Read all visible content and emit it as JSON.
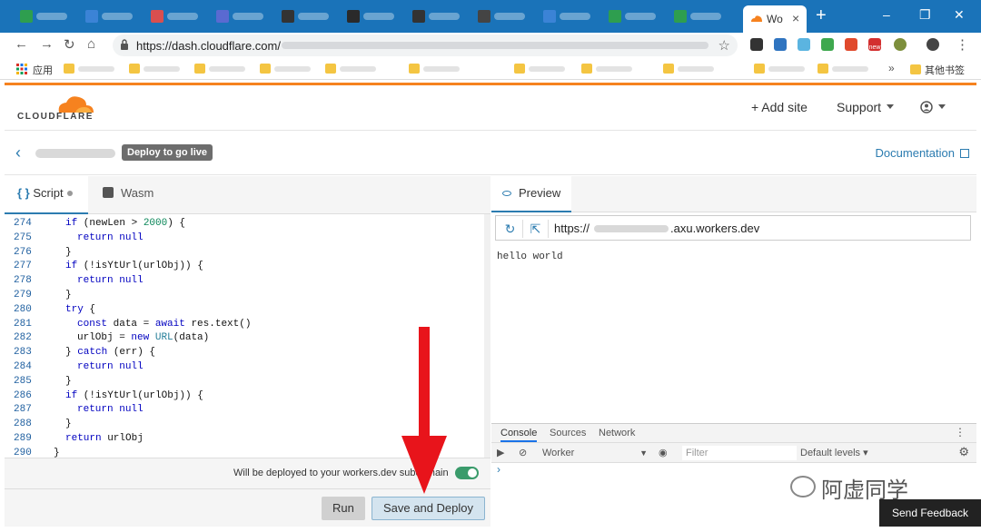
{
  "browser": {
    "active_tab_title": "Wo",
    "url_shown": "https://dash.cloudflare.com/",
    "bookmarks_apps_label": "应用",
    "bookmarks_more": "»",
    "bookmarks_other": "其他书签",
    "extension_badge": "new"
  },
  "header": {
    "logo_text": "CLOUDFLARE",
    "add_site": "+ Add site",
    "support": "Support"
  },
  "subheader": {
    "badge": "Deploy to go live",
    "documentation": "Documentation"
  },
  "editor": {
    "tabs": [
      {
        "label": "Script"
      },
      {
        "label": "Wasm"
      }
    ],
    "lines": [
      {
        "n": "274",
        "indent": 1,
        "code": "if (newLen > 2000) {"
      },
      {
        "n": "275",
        "indent": 2,
        "code": "return null"
      },
      {
        "n": "276",
        "indent": 1,
        "code": "}"
      },
      {
        "n": "277",
        "indent": 1,
        "code": "if (!isYtUrl(urlObj)) {"
      },
      {
        "n": "278",
        "indent": 2,
        "code": "return null"
      },
      {
        "n": "279",
        "indent": 1,
        "code": "}"
      },
      {
        "n": "280",
        "indent": 1,
        "code": "try {"
      },
      {
        "n": "281",
        "indent": 2,
        "code": "const data = await res.text()"
      },
      {
        "n": "282",
        "indent": 2,
        "code": "urlObj = new URL(data)"
      },
      {
        "n": "283",
        "indent": 1,
        "code": "} catch (err) {"
      },
      {
        "n": "284",
        "indent": 2,
        "code": "return null"
      },
      {
        "n": "285",
        "indent": 1,
        "code": "}"
      },
      {
        "n": "286",
        "indent": 1,
        "code": "if (!isYtUrl(urlObj)) {"
      },
      {
        "n": "287",
        "indent": 2,
        "code": "return null"
      },
      {
        "n": "288",
        "indent": 1,
        "code": "}"
      },
      {
        "n": "289",
        "indent": 1,
        "code": "return urlObj"
      },
      {
        "n": "290",
        "indent": 0,
        "code": "}"
      }
    ],
    "deploy_text": "Will be deployed to your workers.dev subdomain",
    "run_label": "Run",
    "save_deploy_label": "Save and Deploy"
  },
  "preview": {
    "tab_label": "Preview",
    "url_prefix": "https://",
    "url_suffix": ".axu.workers.dev",
    "body_text": "hello world",
    "devtools": {
      "tabs": [
        "Console",
        "Sources",
        "Network"
      ],
      "context": "Worker",
      "filter_placeholder": "Filter",
      "levels": "Default levels ▾",
      "prompt": "›"
    }
  },
  "watermark": "阿虚同学",
  "feedback_label": "Send Feedback",
  "colors": {
    "accent": "#f6821f",
    "link": "#2c7cb0",
    "chrome_blue": "#1a73b9",
    "arrow_red": "#e8141b"
  }
}
